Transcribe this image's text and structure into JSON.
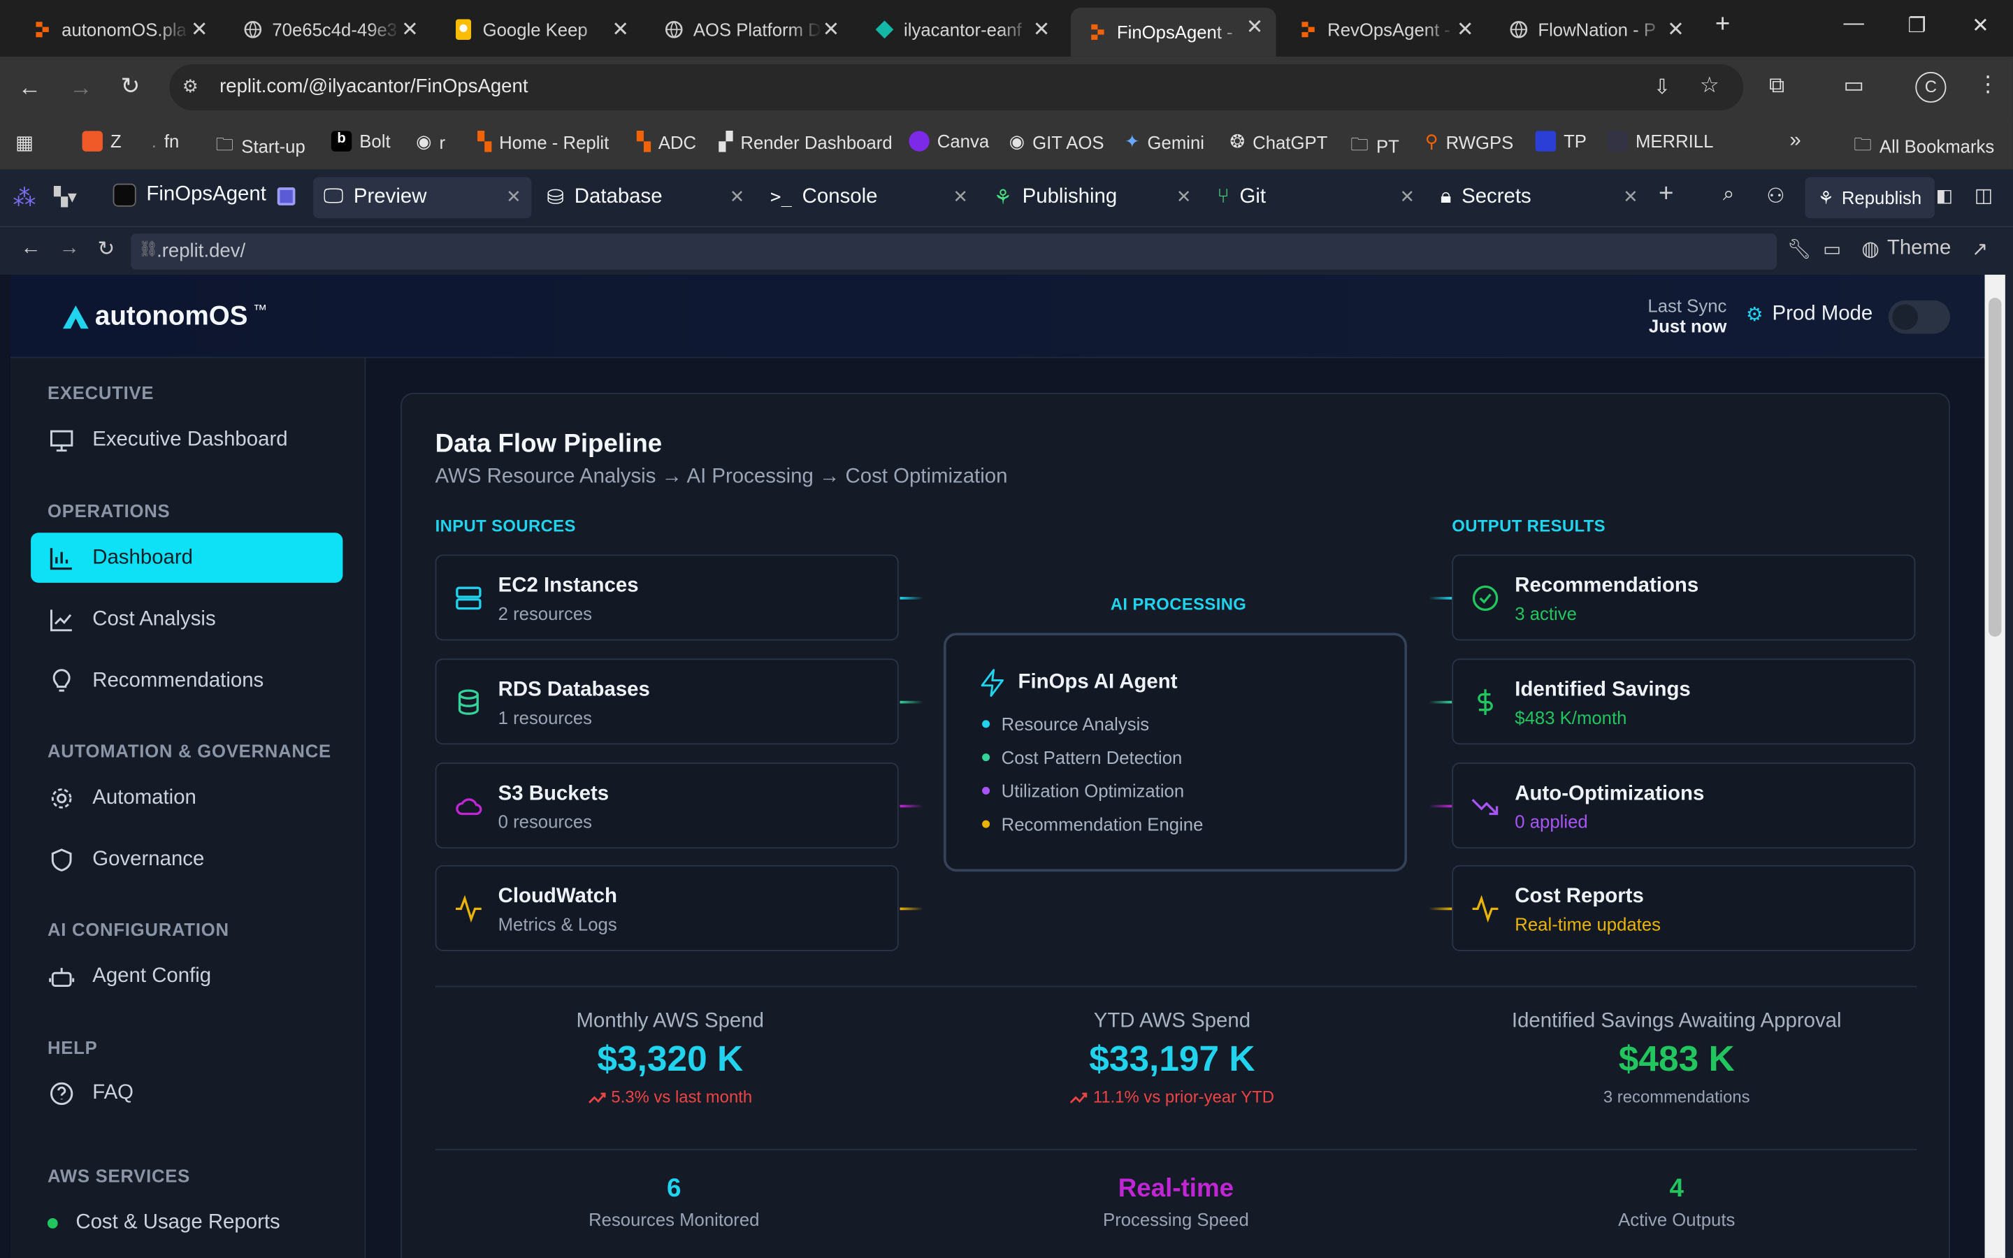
{
  "browser": {
    "tabs": [
      {
        "title": "autonomOS.pla",
        "icon": "replit-icon",
        "active": false
      },
      {
        "title": "70e65c4d-49e3",
        "icon": "globe-icon",
        "active": false
      },
      {
        "title": "Google Keep",
        "icon": "google-keep-icon",
        "active": false
      },
      {
        "title": "AOS Platform D",
        "icon": "globe-icon",
        "active": false
      },
      {
        "title": "ilyacantor-eanf",
        "icon": "render-icon",
        "active": false
      },
      {
        "title": "FinOpsAgent -",
        "icon": "replit-icon",
        "active": true
      },
      {
        "title": "RevOpsAgent -",
        "icon": "replit-icon",
        "active": false
      },
      {
        "title": "FlowNation - P",
        "icon": "globe-icon",
        "active": false
      }
    ],
    "url": "replit.com/@ilyacantor/FinOpsAgent",
    "bookmarks": [
      "Z",
      "fn",
      "Start-up",
      "Bolt",
      "r",
      "Home - Replit",
      "ADC",
      "Render Dashboard",
      "Canva",
      "GIT AOS",
      "Gemini",
      "ChatGPT",
      "PT",
      "RWGPS",
      "TP",
      "MERRILL"
    ],
    "all_bookmarks": "All Bookmarks"
  },
  "replit": {
    "project": "FinOpsAgent",
    "tabs": [
      "Preview",
      "Database",
      "Console",
      "Publishing",
      "Git",
      "Secrets"
    ],
    "republish": "Republish",
    "preview_url": ".replit.dev/",
    "theme": "Theme"
  },
  "app": {
    "logo": "autonomOS",
    "logo_tm": "™",
    "last_sync_label": "Last Sync",
    "last_sync_value": "Just now",
    "mode_label": "Prod Mode",
    "sidebar": [
      {
        "section": "EXECUTIVE",
        "items": [
          {
            "label": "Executive Dashboard",
            "icon": "presentation-icon"
          }
        ]
      },
      {
        "section": "OPERATIONS",
        "items": [
          {
            "label": "Dashboard",
            "icon": "bar-chart-icon",
            "active": true
          },
          {
            "label": "Cost Analysis",
            "icon": "line-chart-icon"
          },
          {
            "label": "Recommendations",
            "icon": "lightbulb-icon"
          }
        ]
      },
      {
        "section": "AUTOMATION & GOVERNANCE",
        "items": [
          {
            "label": "Automation",
            "icon": "cog-icon"
          },
          {
            "label": "Governance",
            "icon": "shield-icon"
          }
        ]
      },
      {
        "section": "AI CONFIGURATION",
        "items": [
          {
            "label": "Agent Config",
            "icon": "bot-icon"
          }
        ]
      },
      {
        "section": "HELP",
        "items": [
          {
            "label": "FAQ",
            "icon": "help-circle-icon"
          }
        ]
      },
      {
        "section": "AWS SERVICES",
        "items": [
          {
            "label": "Cost & Usage Reports",
            "icon": "status-dot-icon"
          }
        ]
      }
    ],
    "pipeline": {
      "title": "Data Flow Pipeline",
      "subtitle": "AWS Resource Analysis → AI Processing → Cost Optimization",
      "inputs_label": "INPUT SOURCES",
      "inputs": [
        {
          "title": "EC2 Instances",
          "sub": "2 resources",
          "icon": "server-icon",
          "color": "#22d3ee"
        },
        {
          "title": "RDS Databases",
          "sub": "1 resources",
          "icon": "database-icon",
          "color": "#34d399"
        },
        {
          "title": "S3 Buckets",
          "sub": "0 resources",
          "icon": "cloud-icon",
          "color": "#c026d3"
        },
        {
          "title": "CloudWatch",
          "sub": "Metrics & Logs",
          "icon": "activity-icon",
          "color": "#eab308"
        }
      ],
      "ai_label": "AI PROCESSING",
      "ai_title": "FinOps AI Agent",
      "ai_items": [
        {
          "label": "Resource Analysis",
          "color": "#22d3ee"
        },
        {
          "label": "Cost Pattern Detection",
          "color": "#34d399"
        },
        {
          "label": "Utilization Optimization",
          "color": "#a855f7"
        },
        {
          "label": "Recommendation Engine",
          "color": "#eab308"
        }
      ],
      "outputs_label": "OUTPUT RESULTS",
      "outputs": [
        {
          "title": "Recommendations",
          "sub": "3 active",
          "icon": "check-circle-icon",
          "color": "#22c55e"
        },
        {
          "title": "Identified Savings",
          "sub": "$483 K/month",
          "icon": "dollar-icon",
          "color": "#22c55e"
        },
        {
          "title": "Auto-Optimizations",
          "sub": "0 applied",
          "icon": "trending-down-icon",
          "color": "#a855f7"
        },
        {
          "title": "Cost Reports",
          "sub": "Real-time updates",
          "icon": "activity-icon",
          "color": "#eab308"
        }
      ]
    },
    "stats": [
      {
        "label": "Monthly AWS Spend",
        "value": "$3,320 K",
        "delta": "5.3% vs last month",
        "color": "#22d3ee",
        "delta_color": "#ef4444"
      },
      {
        "label": "YTD AWS Spend",
        "value": "$33,197 K",
        "delta": "11.1% vs prior-year YTD",
        "color": "#22d3ee",
        "delta_color": "#ef4444"
      },
      {
        "label": "Identified Savings Awaiting Approval",
        "value": "$483 K",
        "delta": "3 recommendations",
        "color": "#22c55e",
        "delta_color": "#9aa4b4"
      }
    ],
    "metrics": [
      {
        "value": "6",
        "label": "Resources Monitored",
        "color": "#22d3ee"
      },
      {
        "value": "Real-time",
        "label": "Processing Speed",
        "color": "#c026d3"
      },
      {
        "value": "4",
        "label": "Active Outputs",
        "color": "#22c55e"
      }
    ]
  }
}
